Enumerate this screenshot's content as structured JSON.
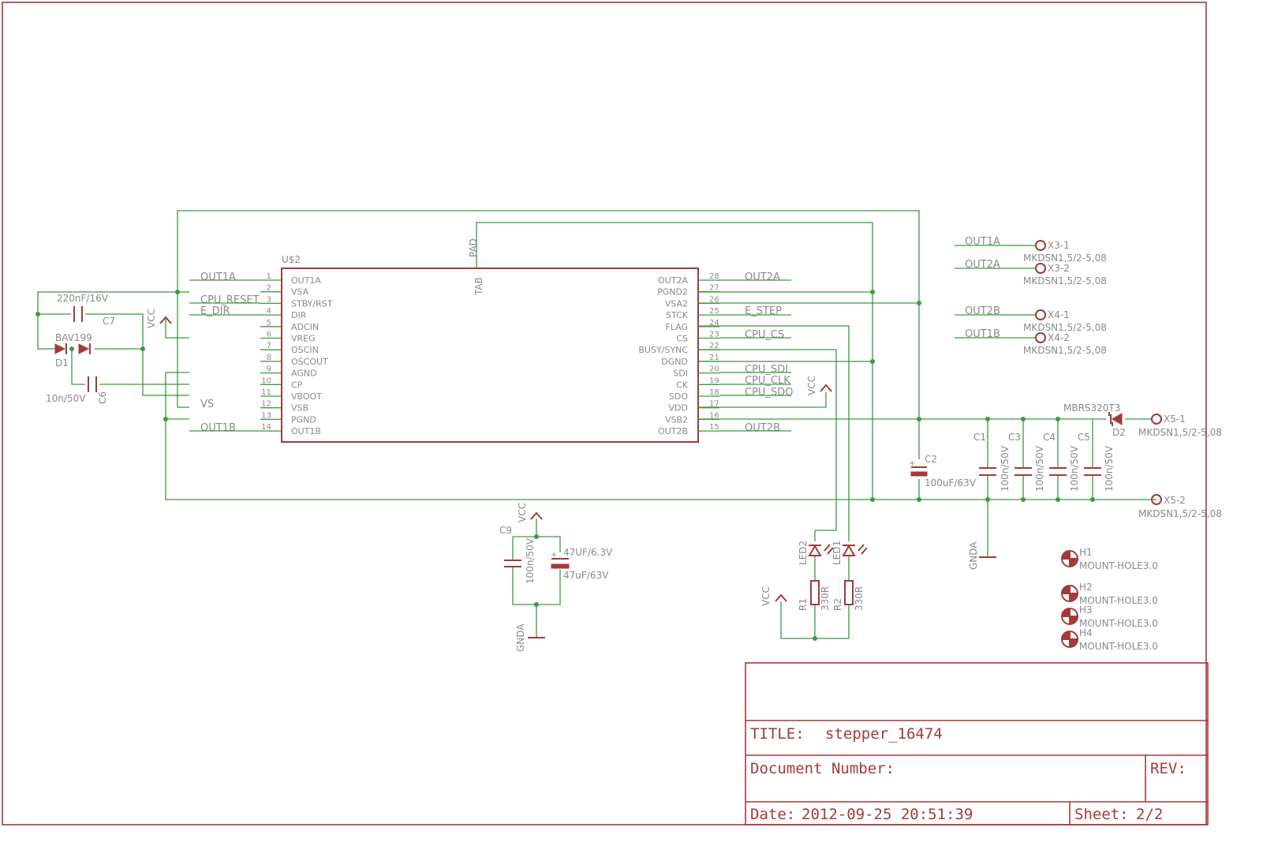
{
  "colors": {
    "frame": "#a33a3a",
    "wire": "#3c9a3c",
    "text": "#8a8a8a"
  },
  "ic": {
    "name": "U$2",
    "pad": "PAD",
    "tab": "TAB",
    "left_pins": [
      {
        "num": "1",
        "name": "OUT1A"
      },
      {
        "num": "2",
        "name": "VSA"
      },
      {
        "num": "3",
        "name": "STBY/RST"
      },
      {
        "num": "4",
        "name": "DIR"
      },
      {
        "num": "5",
        "name": "ADCIN"
      },
      {
        "num": "6",
        "name": "VREG"
      },
      {
        "num": "7",
        "name": "OSCIN"
      },
      {
        "num": "8",
        "name": "OSCOUT"
      },
      {
        "num": "9",
        "name": "AGND"
      },
      {
        "num": "10",
        "name": "CP"
      },
      {
        "num": "11",
        "name": "VBOOT"
      },
      {
        "num": "12",
        "name": "VSB"
      },
      {
        "num": "13",
        "name": "PGND"
      },
      {
        "num": "14",
        "name": "OUT1B"
      }
    ],
    "right_pins": [
      {
        "num": "28",
        "name": "OUT2A"
      },
      {
        "num": "27",
        "name": "PGND2"
      },
      {
        "num": "26",
        "name": "VSA2"
      },
      {
        "num": "25",
        "name": "STCK"
      },
      {
        "num": "24",
        "name": "FLAG"
      },
      {
        "num": "23",
        "name": "CS"
      },
      {
        "num": "22",
        "name": "BUSY/SYNC"
      },
      {
        "num": "21",
        "name": "DGND"
      },
      {
        "num": "20",
        "name": "SDI"
      },
      {
        "num": "19",
        "name": "CK"
      },
      {
        "num": "18",
        "name": "SDO"
      },
      {
        "num": "17",
        "name": "VDD"
      },
      {
        "num": "16",
        "name": "VSB2"
      },
      {
        "num": "15",
        "name": "OUT2B"
      }
    ]
  },
  "nets_left": [
    "OUT1A",
    "CPU_RESET",
    "E_DIR",
    "VS",
    "OUT1B"
  ],
  "nets_right": [
    "OUT2A",
    "E_STEP",
    "CPU_CS",
    "CPU_SDI",
    "CPU_CLK",
    "CPU_SDO",
    "OUT2B"
  ],
  "vcc": "VCC",
  "gnda": "GNDA",
  "parts": {
    "c7_value": "220nF/16V",
    "c7": "C7",
    "d1_value": "BAV199",
    "d1": "D1",
    "c6_value": "10n/50V",
    "c6": "C6",
    "c2": "C2",
    "c2_value": "100uF/63V",
    "c1": "C1",
    "c3": "C3",
    "c4": "C4",
    "c5": "C5",
    "c_value": "100n/50V",
    "d2_value": "MBRS320T3",
    "d2": "D2",
    "c9": "C9",
    "c9_value": "100n/50V",
    "cel1": "47UF/6.3V",
    "cel2": "47uF/63V",
    "led2": "LED2",
    "led1": "LED1",
    "r1": "R1",
    "r2": "R2",
    "r_value": "330R"
  },
  "connectors": [
    {
      "net": "OUT1A",
      "pin": "X3-1",
      "part": "MKDSN1,5/2-5,08"
    },
    {
      "net": "OUT2A",
      "pin": "X3-2",
      "part": "MKDSN1,5/2-5,08"
    },
    {
      "net": "OUT2B",
      "pin": "X4-1",
      "part": "MKDSN1,5/2-5,08"
    },
    {
      "net": "OUT1B",
      "pin": "X4-2",
      "part": "MKDSN1,5/2-5,08"
    }
  ],
  "x5": [
    {
      "pin": "X5-1",
      "part": "MKDSN1,5/2-5,08"
    },
    {
      "pin": "X5-2",
      "part": "MKDSN1,5/2-5,08"
    }
  ],
  "holes": [
    {
      "name": "H1",
      "part": "MOUNT-HOLE3.0"
    },
    {
      "name": "H2",
      "part": "MOUNT-HOLE3.0"
    },
    {
      "name": "H3",
      "part": "MOUNT-HOLE3.0"
    },
    {
      "name": "H4",
      "part": "MOUNT-HOLE3.0"
    }
  ],
  "titleblock": {
    "title_label": "TITLE:",
    "title": "stepper_16474",
    "docnum_label": "Document Number:",
    "rev_label": "REV:",
    "date_label": "Date:",
    "date": "2012-09-25 20:51:39",
    "sheet_label": "Sheet:",
    "sheet": "2/2"
  }
}
